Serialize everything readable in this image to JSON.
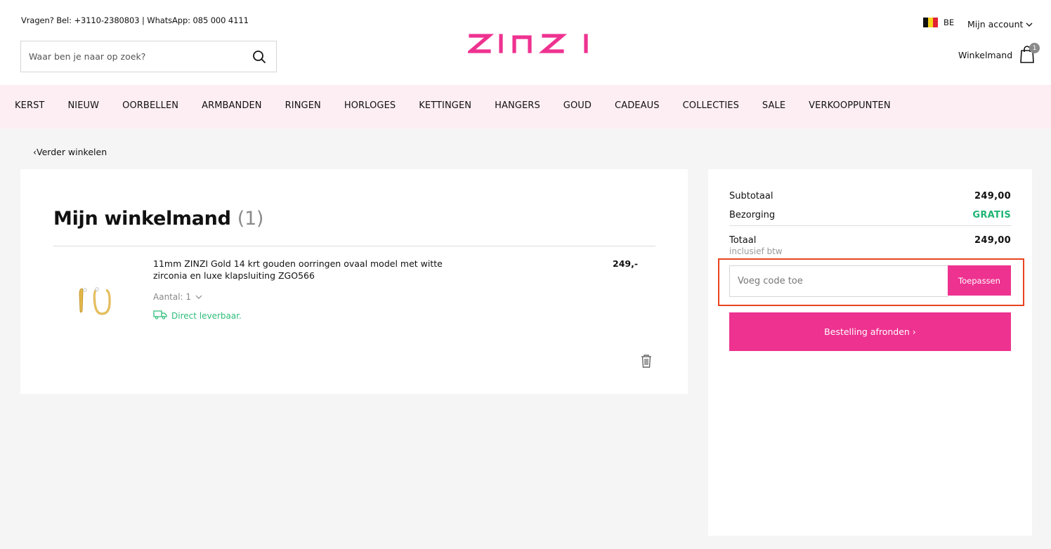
{
  "header": {
    "contact": "Vragen? Bel: +3110-2380803 | WhatsApp: 085 000 4111",
    "search_placeholder": "Waar ben je naar op zoek?",
    "logo_text": "ZINZI",
    "country": "BE",
    "account_label": "Mijn account",
    "cart_label": "Winkelmand",
    "cart_count": "1"
  },
  "nav": {
    "items": [
      "KERST",
      "NIEUW",
      "OORBELLEN",
      "ARMBANDEN",
      "RINGEN",
      "HORLOGES",
      "KETTINGEN",
      "HANGERS",
      "GOUD",
      "CADEAUS",
      "COLLECTIES",
      "SALE",
      "VERKOOPPUNTEN"
    ]
  },
  "back_link": "Verder winkelen",
  "cart": {
    "title": "Mijn winkelmand",
    "count": "(1)",
    "items": [
      {
        "name": "11mm ZINZI Gold 14 krt gouden oorringen ovaal model met witte zirconia en luxe klapsluiting ZGO566",
        "price": "249,-",
        "quantity": "Aantal: 1",
        "stock": "Direct leverbaar."
      }
    ]
  },
  "summary": {
    "subtotal_label": "Subtotaal",
    "subtotal_value": "249,00",
    "delivery_label": "Bezorging",
    "delivery_value": "GRATIS",
    "total_label": "Totaal",
    "total_note": "inclusief btw",
    "total_value": "249,00",
    "coupon_placeholder": "Voeg code toe",
    "coupon_button": "Toepassen",
    "checkout_button": "Bestelling afronden ›"
  },
  "colors": {
    "brand_pink": "#ee3290",
    "nav_background": "#fdeef3",
    "success_green": "#1fb574",
    "highlight_frame": "#e8431f"
  }
}
